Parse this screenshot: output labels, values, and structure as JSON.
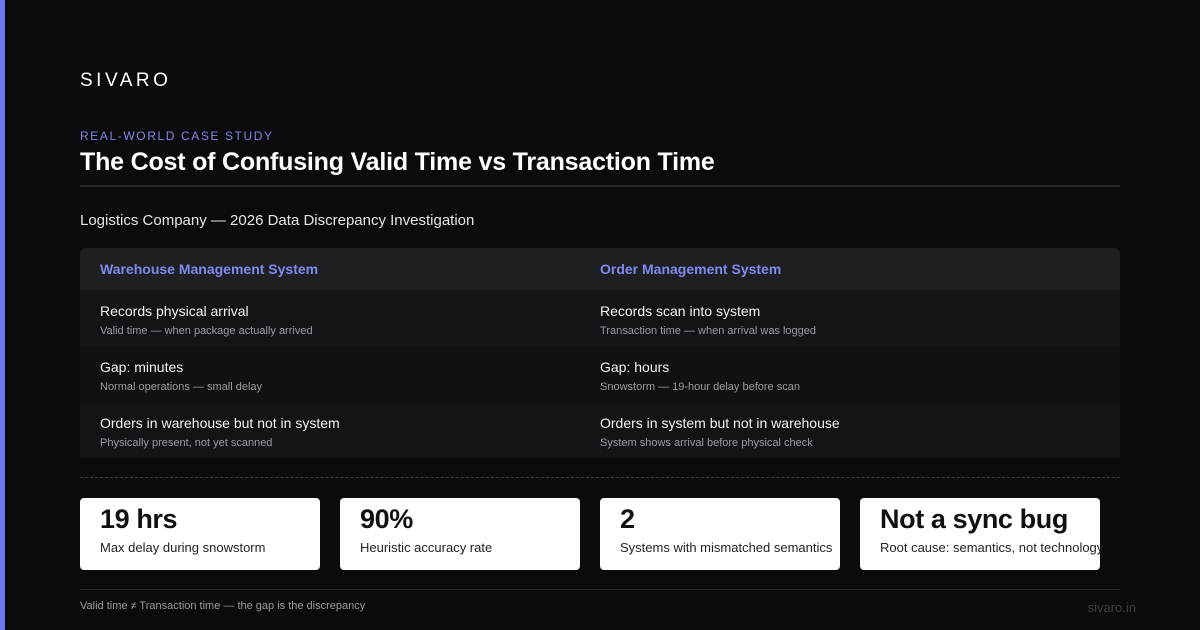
{
  "brand": "SIVARO",
  "eyebrow": "REAL-WORLD CASE STUDY",
  "title": "The Cost of Confusing Valid Time vs Transaction Time",
  "subtitle": "Logistics Company — 2026 Data Discrepancy Investigation",
  "colors": {
    "accent": "#6f78f0",
    "background": "#0b0b0e",
    "header_text": "#8189ec",
    "card": "#ffffff"
  },
  "table": {
    "headers": [
      "Warehouse Management System",
      "Order Management System"
    ],
    "rows": [
      [
        {
          "main": "Records physical arrival",
          "sub": "Valid time — when package actually arrived"
        },
        {
          "main": "Records scan into system",
          "sub": "Transaction time — when arrival was logged"
        }
      ],
      [
        {
          "main": "Gap: minutes",
          "sub": "Normal operations — small delay"
        },
        {
          "main": "Gap: hours",
          "sub": "Snowstorm — 19-hour delay before scan"
        }
      ],
      [
        {
          "main": "Orders in warehouse but not in system",
          "sub": "Physically present, not yet scanned"
        },
        {
          "main": "Orders in system but not in warehouse",
          "sub": "System shows arrival before physical check"
        }
      ]
    ]
  },
  "stats": [
    {
      "value": "19 hrs",
      "label": "Max delay during snowstorm"
    },
    {
      "value": "90%",
      "label": "Heuristic accuracy rate"
    },
    {
      "value": "2",
      "label": "Systems with mismatched semantics"
    },
    {
      "value": "Not a sync bug",
      "label": "Root cause: semantics, not technology"
    }
  ],
  "footer": {
    "note": "Valid time ≠ Transaction time — the gap is the discrepancy",
    "url": "sivaro.in"
  }
}
